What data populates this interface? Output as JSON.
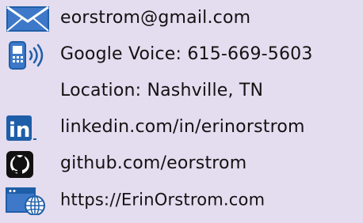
{
  "contact": {
    "email": {
      "icon": "envelope-icon",
      "text": "eorstrom@gmail.com"
    },
    "phone": {
      "icon": "phone-icon",
      "text": "Google Voice: 615-669-5603"
    },
    "location": {
      "text": "Location: Nashville, TN"
    },
    "linkedin": {
      "icon": "linkedin-icon",
      "icon_text": "in",
      "text": "linkedin.com/in/erinorstrom"
    },
    "github": {
      "icon": "github-icon",
      "text": "github.com/eorstrom"
    },
    "website": {
      "icon": "globe-window-icon",
      "text": "https://ErinOrstrom.com"
    }
  },
  "colors": {
    "background": "#e4dcef",
    "text": "#121212",
    "icon_blue": "#1e5ea8",
    "icon_light_blue": "#3e79c9"
  }
}
